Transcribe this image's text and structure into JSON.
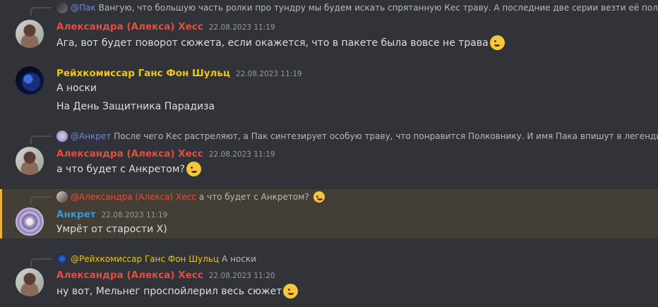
{
  "colors": {
    "background": "#313338",
    "alexa": "#e74c3c",
    "reich": "#f1c40f",
    "ankret": "#3498db",
    "pak": "#7289da",
    "highlight_border": "#f0b132"
  },
  "messages": [
    {
      "reply": {
        "mention": "@Пак",
        "text": "Вангую, что большую часть ролки про тундру мы будем искать спрятанную Кес траву. А последние две серии везти её полковни"
      },
      "author": "Александра (Алекса) Хесс",
      "timestamp": "22.08.2023 11:19",
      "lines": [
        "Ага, вот будет поворот сюжета, если окажется, что в пакете была вовсе не трава"
      ],
      "emoji": "rolling-on-floor-laughing"
    },
    {
      "author": "Рейхкомиссар Ганс Фон Шульц",
      "timestamp": "22.08.2023 11:19",
      "lines": [
        "А носки",
        "На День Защитника Парадиза"
      ]
    },
    {
      "reply": {
        "mention": "@Анкрет",
        "text": "После чего Кес растреляют, а Пак синтезирует особую траву, что понравится Полковнику. И имя Пака впишут в легенды)"
      },
      "author": "Александра (Алекса) Хесс",
      "timestamp": "22.08.2023 11:19",
      "lines": [
        "а что будет с Анкретом?"
      ],
      "emoji": "winking-face"
    },
    {
      "reply": {
        "mention": "@Александра (Алекса) Хесс",
        "text": "а что будет с Анкретом?"
      },
      "author": "Анкрет",
      "timestamp": "22.08.2023 11:19",
      "lines": [
        "Умрёт от старости Х)"
      ]
    },
    {
      "reply": {
        "mention": "@Рейхкомиссар Ганс Фон Шульц",
        "text": "А носки"
      },
      "author": "Александра (Алекса) Хесс",
      "timestamp": "22.08.2023 11:20",
      "lines": [
        "ну вот, Мельнег проспойлерил весь сюжет"
      ],
      "emoji": "grinning-squinting-face"
    }
  ]
}
